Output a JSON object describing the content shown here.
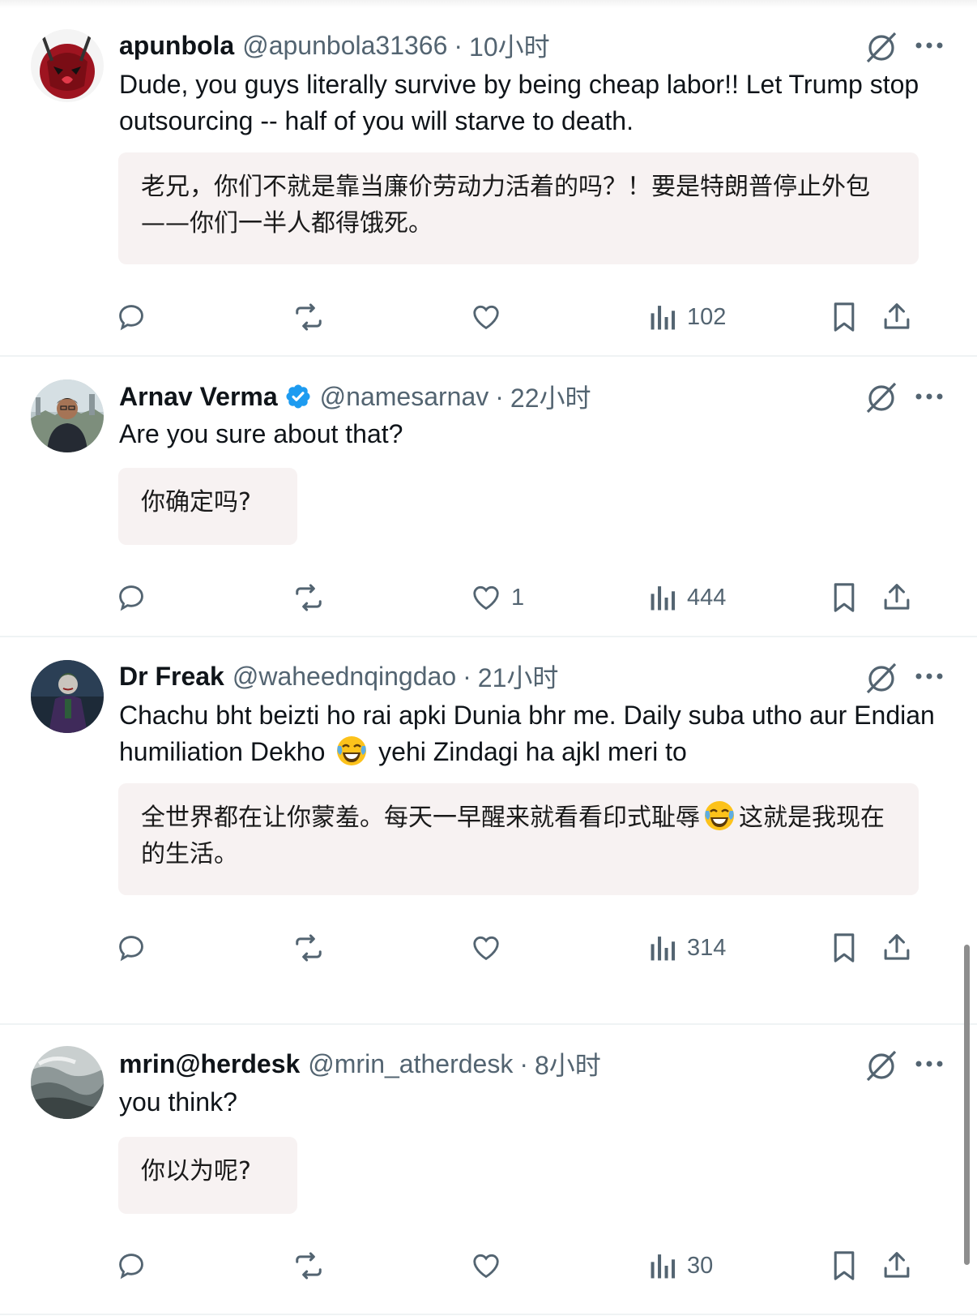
{
  "tweets": [
    {
      "name": "apunbola",
      "handle": "@apunbola31366",
      "separator": "·",
      "time": "10小时",
      "verified": false,
      "text": "Dude, you guys literally survive by being cheap labor!! Let Trump stop outsourcing -- half of you will starve to death.",
      "translation": "老兄，你们不就是靠当廉价劳动力活着的吗？！要是特朗普停止外包——你们一半人都得饿死。",
      "replies": "",
      "reposts": "",
      "likes": "",
      "views": "102"
    },
    {
      "name": "Arnav Verma",
      "handle": "@namesarnav",
      "separator": "·",
      "time": "22小时",
      "verified": true,
      "text": "Are you sure about that?",
      "translation": "你确定吗?",
      "replies": "",
      "reposts": "",
      "likes": "1",
      "views": "444"
    },
    {
      "name": "Dr Freak",
      "handle": "@waheednqingdao",
      "separator": "·",
      "time": "21小时",
      "verified": false,
      "text_before_emoji": "Chachu bht beizti ho rai apki Dunia bhr me. Daily suba utho aur Endian humiliation Dekho",
      "text_after_emoji": "yehi Zindagi ha ajkl meri to",
      "translation_before_emoji": "全世界都在让你蒙羞。每天一早醒来就看看印式耻辱",
      "translation_after_emoji": "这就是我现在的生活。",
      "emoji": "face-with-tears-of-joy",
      "replies": "",
      "reposts": "",
      "likes": "",
      "views": "314"
    },
    {
      "name": "mrin@herdesk",
      "handle": "@mrin_atherdesk",
      "separator": "·",
      "time": "8小时",
      "verified": false,
      "text": "you think?",
      "translation": "你以为呢?",
      "replies": "",
      "reposts": "",
      "likes": "",
      "views": "30"
    }
  ],
  "icons": {
    "reply": "reply-icon",
    "repost": "repost-icon",
    "like": "like-icon",
    "views": "views-icon",
    "bookmark": "bookmark-icon",
    "share": "share-icon",
    "grok": "grok-icon",
    "more": "more-icon",
    "verified": "verified-badge-icon"
  },
  "colors": {
    "text": "#0f1419",
    "secondary": "#536471",
    "translation_bg": "#f7f2f2",
    "verified": "#1d9bf0",
    "divider": "#eff3f4"
  }
}
